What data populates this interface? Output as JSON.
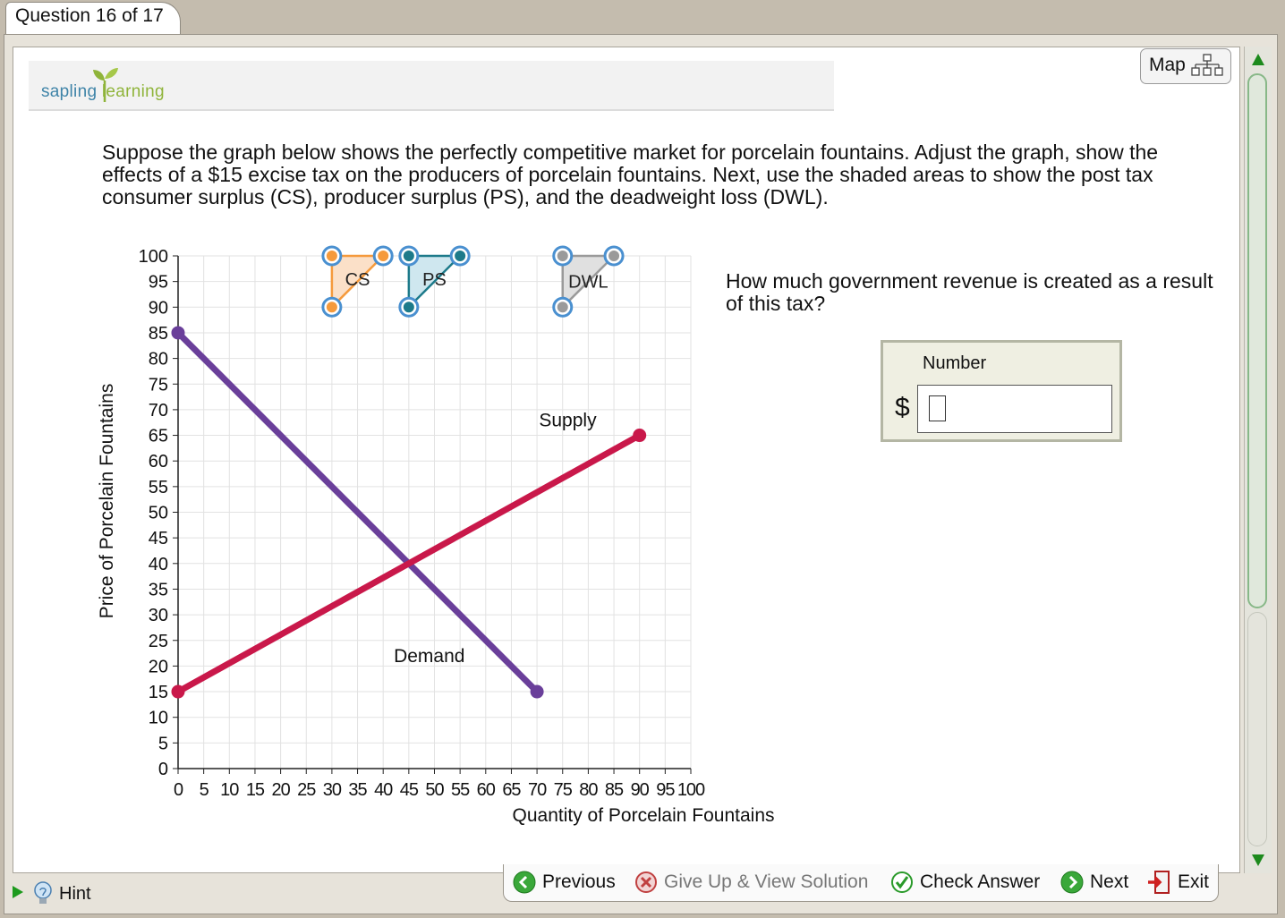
{
  "tab": {
    "label": "Question 16 of 17"
  },
  "logo": {
    "part1": "sapling",
    "part2": "learning"
  },
  "map": {
    "label": "Map"
  },
  "question": {
    "text": "Suppose the graph below shows the perfectly competitive market for porcelain fountains. Adjust the graph, show the effects of a $15 excise tax on the producers of porcelain fountains.  Next, use the shaded areas to show the post tax consumer surplus (CS), producer surplus (PS), and the deadweight loss (DWL)."
  },
  "side_question": {
    "text": "How much government revenue is created as a result of this tax?",
    "input_label": "Number",
    "currency": "$",
    "value": ""
  },
  "chart_data": {
    "type": "line",
    "xlabel": "Quantity of Porcelain Fountains",
    "ylabel": "Price of Porcelain Fountains",
    "xlim": [
      0,
      100
    ],
    "ylim": [
      0,
      100
    ],
    "xticks": [
      0,
      5,
      10,
      15,
      20,
      25,
      30,
      35,
      40,
      45,
      50,
      55,
      60,
      65,
      70,
      75,
      80,
      85,
      90,
      95,
      100
    ],
    "yticks": [
      0,
      5,
      10,
      15,
      20,
      25,
      30,
      35,
      40,
      45,
      50,
      55,
      60,
      65,
      70,
      75,
      80,
      85,
      90,
      95,
      100
    ],
    "grid": true,
    "series": [
      {
        "name": "Demand",
        "color": "#6a3f9a",
        "points": [
          [
            0,
            85
          ],
          [
            70,
            15
          ]
        ],
        "label_at": [
          49,
          22
        ]
      },
      {
        "name": "Supply",
        "color": "#c9184a",
        "points": [
          [
            0,
            15
          ],
          [
            90,
            65
          ]
        ],
        "label_at": [
          76,
          68
        ]
      }
    ],
    "shapes": [
      {
        "name": "CS",
        "fill": "#fbe0c8",
        "stroke": "#f59a3c",
        "points": [
          [
            30,
            100
          ],
          [
            40,
            100
          ],
          [
            30,
            90
          ]
        ],
        "label_at": [
          35,
          95.5
        ]
      },
      {
        "name": "PS",
        "fill": "#cfe7ef",
        "stroke": "#1d7a8a",
        "points": [
          [
            45,
            100
          ],
          [
            55,
            100
          ],
          [
            45,
            90
          ]
        ],
        "label_at": [
          50,
          95.5
        ]
      },
      {
        "name": "DWL",
        "fill": "#e0e0e0",
        "stroke": "#9a9a9a",
        "points": [
          [
            75,
            100
          ],
          [
            85,
            100
          ],
          [
            75,
            90
          ]
        ],
        "label_at": [
          80,
          95
        ]
      }
    ]
  },
  "hint": {
    "label": "Hint"
  },
  "nav": {
    "previous": "Previous",
    "give_up": "Give Up & View Solution",
    "check": "Check Answer",
    "next": "Next",
    "exit": "Exit"
  },
  "colors": {
    "accent_green": "#1d9a1d",
    "demand": "#6a3f9a",
    "supply": "#c9184a"
  },
  "icons": [
    "map-icon",
    "hint-play-icon",
    "lightbulb-icon",
    "previous-arrow-icon",
    "give-up-x-icon",
    "check-icon",
    "next-arrow-icon",
    "exit-door-icon",
    "scroll-up-icon",
    "scroll-down-icon"
  ]
}
